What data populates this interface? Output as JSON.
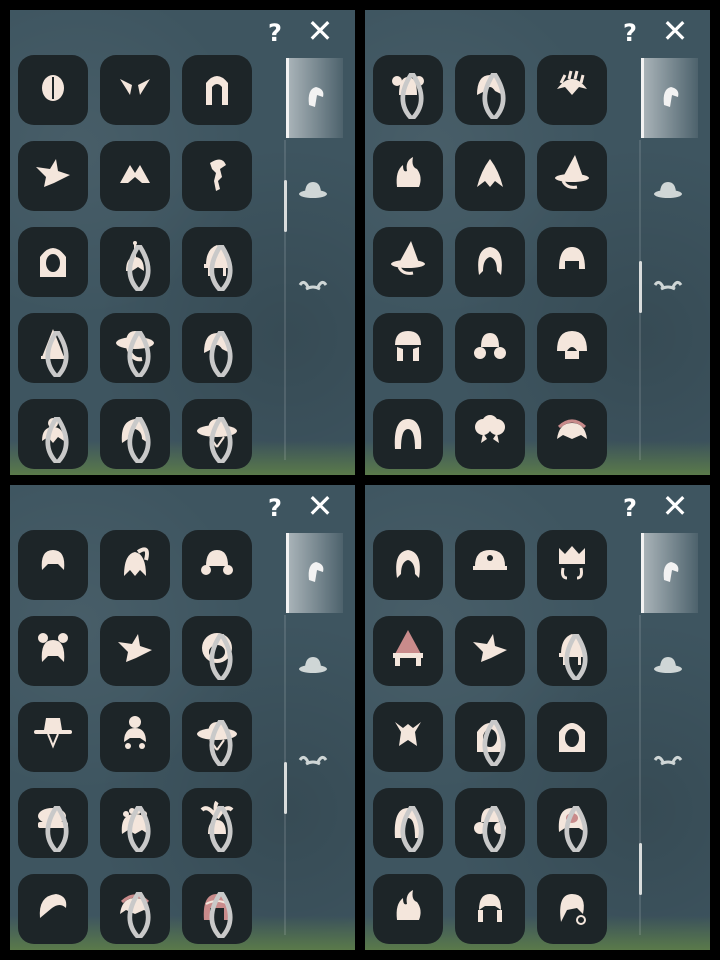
{
  "colors": {
    "panel_bg": "#3e5560",
    "tile_bg": "#1d2528",
    "icon": "#f4e6dc",
    "accent": "#c98b8b"
  },
  "top_buttons": {
    "help_label": "?",
    "close_label": "✕"
  },
  "tabs": [
    {
      "name": "hair-tab",
      "icon": "hair-icon",
      "active": true
    },
    {
      "name": "hat-tab",
      "icon": "hat-icon",
      "active": false
    },
    {
      "name": "horns-tab",
      "icon": "horns-icon",
      "active": false
    }
  ],
  "panels": [
    {
      "scroll_position": 0.15,
      "items": [
        {
          "icon": "hair-short-icon",
          "drop": false
        },
        {
          "icon": "hair-wings-icon",
          "drop": false
        },
        {
          "icon": "hair-long-braids-icon",
          "drop": false
        },
        {
          "icon": "hair-spiky-icon",
          "drop": false
        },
        {
          "icon": "hair-peak-icon",
          "drop": false
        },
        {
          "icon": "hair-side-braid-icon",
          "drop": false
        },
        {
          "icon": "hood-icon",
          "drop": false
        },
        {
          "icon": "hair-antenna-icon",
          "drop": true
        },
        {
          "icon": "hat-bell-icon",
          "drop": true
        },
        {
          "icon": "hat-cone-icon",
          "drop": true
        },
        {
          "icon": "hat-wide-brim-icon",
          "drop": true
        },
        {
          "icon": "hair-bob-icon",
          "drop": true
        },
        {
          "icon": "hair-topknot-icon",
          "drop": true
        },
        {
          "icon": "hair-curly-icon",
          "drop": true
        },
        {
          "icon": "hat-straw-icon",
          "drop": true
        }
      ]
    },
    {
      "scroll_position": 0.45,
      "items": [
        {
          "icon": "hair-pigtails-icon",
          "drop": true
        },
        {
          "icon": "hair-bob-icon",
          "drop": true
        },
        {
          "icon": "hair-mohawk-icon",
          "drop": false
        },
        {
          "icon": "hair-flame-icon",
          "drop": false
        },
        {
          "icon": "hair-swirl-icon",
          "drop": false
        },
        {
          "icon": "hat-witch-icon",
          "drop": false
        },
        {
          "icon": "hat-witch-icon",
          "drop": false
        },
        {
          "icon": "hair-wavy-icon",
          "drop": false
        },
        {
          "icon": "hair-helmet-icon",
          "drop": false
        },
        {
          "icon": "hair-turban-icon",
          "drop": false
        },
        {
          "icon": "hair-buns-icon",
          "drop": false
        },
        {
          "icon": "hair-mushroom-icon",
          "drop": false
        },
        {
          "icon": "hair-long-icon",
          "drop": false
        },
        {
          "icon": "hair-fluffy-icon",
          "drop": false
        },
        {
          "icon": "hair-headband-icon",
          "drop": false
        }
      ]
    },
    {
      "scroll_position": 0.55,
      "items": [
        {
          "icon": "hair-round-icon",
          "drop": false
        },
        {
          "icon": "hair-ponytail-icon",
          "drop": false
        },
        {
          "icon": "hair-curls-icon",
          "drop": false
        },
        {
          "icon": "hair-bear-ears-icon",
          "drop": false
        },
        {
          "icon": "hair-spiky-icon",
          "drop": false
        },
        {
          "icon": "hair-afro-icon",
          "drop": true
        },
        {
          "icon": "hat-cowboy-icon",
          "drop": false
        },
        {
          "icon": "hair-bun-icon",
          "drop": false
        },
        {
          "icon": "hat-straw-icon",
          "drop": true
        },
        {
          "icon": "hat-beret-icon",
          "drop": true
        },
        {
          "icon": "hair-flower-crown-icon",
          "drop": true
        },
        {
          "icon": "hair-palm-icon",
          "drop": true
        },
        {
          "icon": "hair-swoop-icon",
          "drop": false
        },
        {
          "icon": "hair-headband-icon",
          "drop": true
        },
        {
          "icon": "hair-bonnet-icon",
          "drop": true
        }
      ]
    },
    {
      "scroll_position": 0.85,
      "items": [
        {
          "icon": "hair-wavy-icon",
          "drop": false
        },
        {
          "icon": "hat-cap-icon",
          "drop": false
        },
        {
          "icon": "hat-crown-icon",
          "drop": false
        },
        {
          "icon": "hat-gnome-icon",
          "drop": false
        },
        {
          "icon": "hair-spiky-icon",
          "drop": false
        },
        {
          "icon": "hat-bell-icon",
          "drop": true
        },
        {
          "icon": "hair-horned-icon",
          "drop": false
        },
        {
          "icon": "hood-icon",
          "drop": true
        },
        {
          "icon": "hood-icon",
          "drop": false
        },
        {
          "icon": "hair-long-icon",
          "drop": true
        },
        {
          "icon": "hair-buns-icon",
          "drop": true
        },
        {
          "icon": "hair-mask-icon",
          "drop": true
        },
        {
          "icon": "hair-flame-icon",
          "drop": false
        },
        {
          "icon": "hair-braids-icon",
          "drop": false
        },
        {
          "icon": "hair-earring-icon",
          "drop": false
        }
      ]
    }
  ]
}
